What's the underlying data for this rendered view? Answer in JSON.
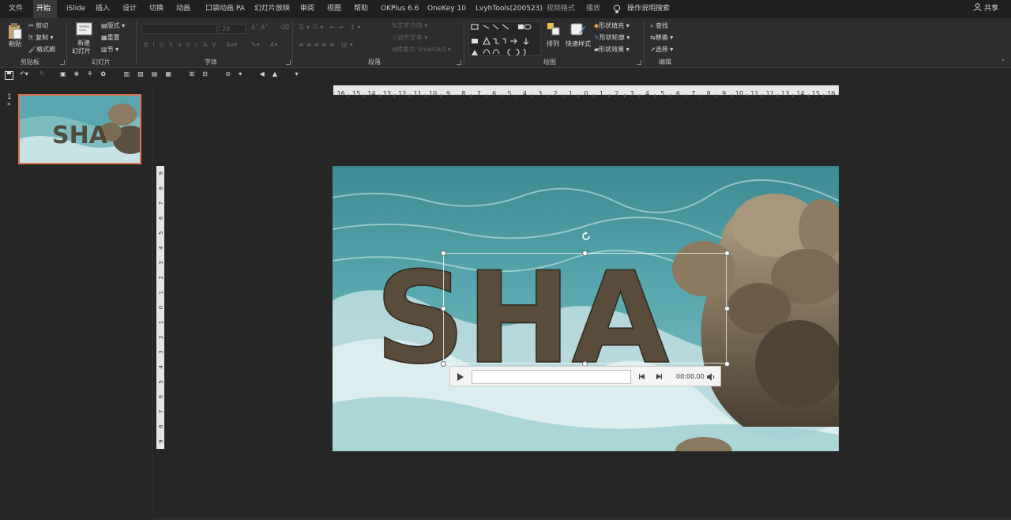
{
  "menu": {
    "tabs": [
      "文件",
      "开始",
      "iSlide",
      "插入",
      "设计",
      "切换",
      "动画",
      "口袋动画 PA",
      "幻灯片放映",
      "审阅",
      "视图",
      "帮助",
      "OKPlus 6.6",
      "OneKey 10",
      "LvyhTools(200523)",
      "视频格式",
      "播放"
    ],
    "active": "开始",
    "tell_me": "操作说明搜索",
    "share": "共享"
  },
  "ribbon": {
    "clipboard": {
      "paste": "粘贴",
      "cut": "剪切",
      "copy": "复制",
      "format_painter": "格式刷",
      "label": "剪贴板"
    },
    "slides": {
      "new_slide": "新建",
      "new_slide2": "幻灯片",
      "layout": "版式",
      "reset": "重置",
      "section": "节",
      "label": "幻灯片"
    },
    "font": {
      "size": "20",
      "label": "字体"
    },
    "paragraph": {
      "text_direction": "文字方向",
      "align_text": "对齐文本",
      "smartart": "转换为 SmartArt",
      "label": "段落"
    },
    "drawing": {
      "arrange": "排列",
      "quick_styles": "快速样式",
      "shape_fill": "形状填充",
      "shape_outline": "形状轮廓",
      "shape_effects": "形状效果",
      "label": "绘图"
    },
    "editing": {
      "find": "查找",
      "replace": "替换",
      "select": "选择",
      "label": "编辑"
    }
  },
  "thumbnails": {
    "number": "1",
    "star": "*"
  },
  "slide": {
    "headline": "SHA"
  },
  "player": {
    "time": "00:00.00"
  },
  "ruler": {
    "h_ticks": [
      "16",
      "15",
      "14",
      "13",
      "12",
      "11",
      "10",
      "9",
      "8",
      "7",
      "6",
      "5",
      "4",
      "3",
      "2",
      "1",
      "0",
      "1",
      "2",
      "3",
      "4",
      "5",
      "6",
      "7",
      "8",
      "9",
      "10",
      "11",
      "12",
      "13",
      "14",
      "15",
      "16"
    ],
    "v_ticks": [
      "9",
      "8",
      "7",
      "6",
      "5",
      "4",
      "3",
      "2",
      "1",
      "0",
      "1",
      "2",
      "3",
      "4",
      "5",
      "6",
      "7",
      "8",
      "9"
    ]
  },
  "colors": {
    "accent": "#e0704a",
    "dark_bg": "#262626",
    "ribbon_bg": "#2d2d2d",
    "water": "#4a9ba3",
    "rock": "#6b5c46"
  }
}
